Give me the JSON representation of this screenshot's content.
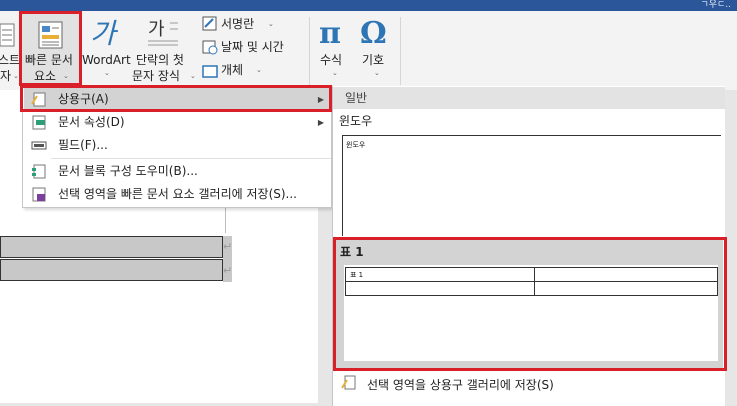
{
  "title_corner": "ㄱ우ㄷ..",
  "ribbon": {
    "textbox_label_1": "스트",
    "textbox_label_2": "자",
    "quickparts_label_1": "빠른 문서",
    "quickparts_label_2": "요소",
    "wordart_label": "WordArt",
    "dropcap_label_1": "단락의 첫",
    "dropcap_label_2": "문자 장식",
    "signature_label": "서명란",
    "datetime_label": "날짜 및 시간",
    "object_label": "개체",
    "equation_label": "수식",
    "symbol_label": "기호",
    "wordart_icon_glyph": "가",
    "dropcap_icon_glyph": "가",
    "equation_icon_glyph": "π",
    "symbol_icon_glyph": "Ω"
  },
  "menu": {
    "items": [
      {
        "label": "상용구(A)",
        "has_submenu": true,
        "icon": "autotext-icon"
      },
      {
        "label": "문서 속성(D)",
        "has_submenu": true,
        "icon": "document-property-icon"
      },
      {
        "label": "필드(F)...",
        "has_submenu": false,
        "icon": "field-icon"
      },
      {
        "label": "문서 블록 구성 도우미(B)...",
        "has_submenu": false,
        "icon": "building-blocks-organizer-icon"
      },
      {
        "label": "선택 영역을 빠른 문서 요소 갤러리에 저장(S)...",
        "has_submenu": false,
        "icon": "save-selection-icon"
      }
    ]
  },
  "gallery": {
    "header": "일반",
    "category": "윈도우",
    "window_preview_text": "윈도우",
    "table_item_caption": "표 1",
    "table_preview_text": "표 1",
    "footer_label": "선택 영역을 상용구 갤러리에 저장(S)"
  },
  "document": {
    "pilcrow": "↵"
  },
  "colors": {
    "titlebar": "#2b579a",
    "highlight_box": "#d9202a",
    "menu_hover": "#d3d3d3"
  }
}
